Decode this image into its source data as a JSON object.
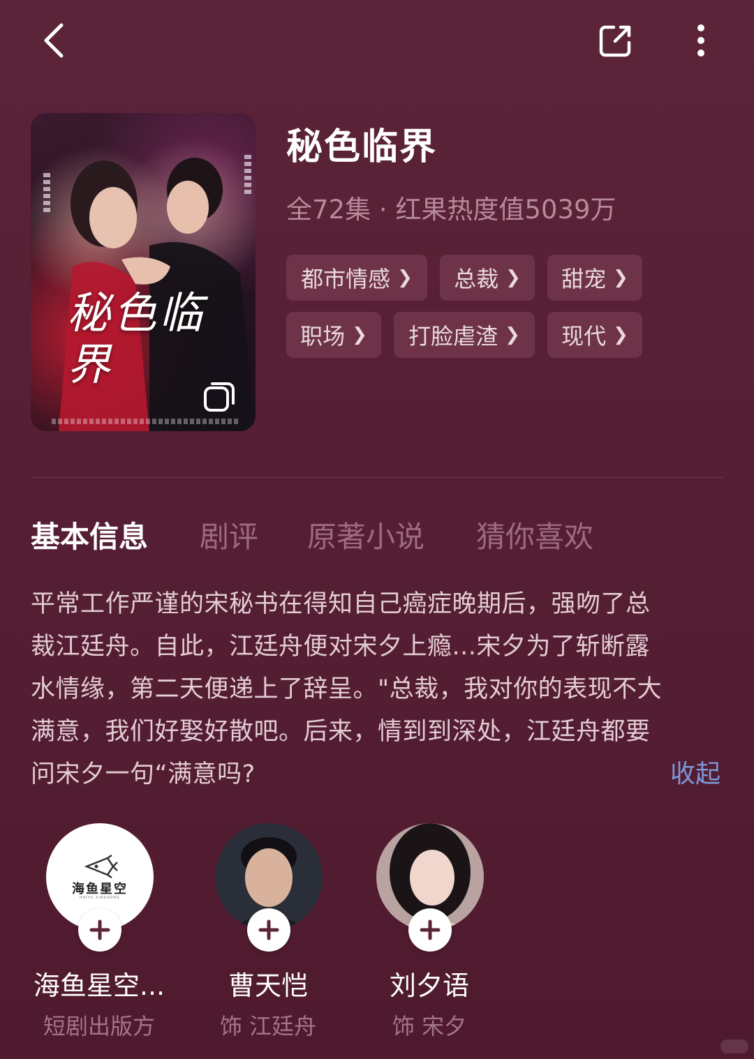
{
  "icons": {
    "back": "back-arrow-icon",
    "share": "share-icon",
    "more": "more-vertical-icon",
    "follow": "plus-icon"
  },
  "drama": {
    "title": "秘色临界",
    "meta": "全72集 · 红果热度值5039万",
    "poster_title": "秘色临界"
  },
  "tags": [
    {
      "label": "都市情感"
    },
    {
      "label": "总裁"
    },
    {
      "label": "甜宠"
    },
    {
      "label": "职场"
    },
    {
      "label": "打脸虐渣"
    },
    {
      "label": "现代"
    }
  ],
  "tabs": [
    {
      "label": "基本信息",
      "active": true
    },
    {
      "label": "剧评",
      "active": false
    },
    {
      "label": "原著小说",
      "active": false
    },
    {
      "label": "猜你喜欢",
      "active": false
    }
  ],
  "synopsis": {
    "lines": [
      "平常工作严谨的宋秘书在得知自己癌症晚期后，强吻了总",
      "裁江廷舟。自此，江廷舟便对宋夕上瘾...宋夕为了斩断露",
      "水情缘，第二天便递上了辞呈。\"总裁，我对你的表现不大",
      "满意，我们好娶好散吧。后来，情到到深处，江廷舟都要",
      "问宋夕一句“满意吗?"
    ],
    "collapse_label": "收起"
  },
  "people": [
    {
      "name": "海鱼星空...",
      "role": "短剧出版方",
      "logo_text": "海鱼星空",
      "logo_sub": "HAIYU XINGKONG"
    },
    {
      "name": "曹天恺",
      "role": "饰 江廷舟"
    },
    {
      "name": "刘夕语",
      "role": "饰 宋夕"
    }
  ],
  "colors": {
    "background": "#561f35",
    "tag_bg": "#6e3348",
    "link": "#7e98d8",
    "muted": "#b78a9b"
  }
}
